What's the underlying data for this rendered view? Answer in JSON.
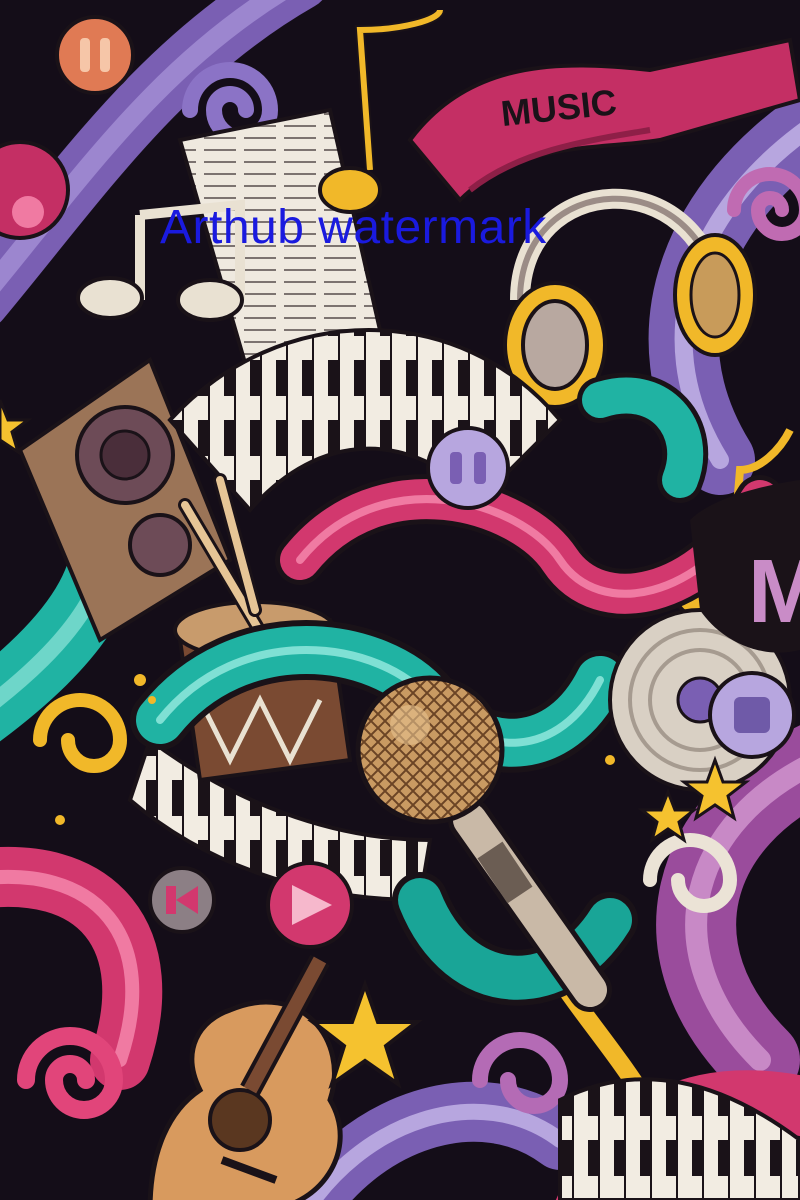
{
  "artwork": {
    "banner_text": "MUSIC",
    "side_letter": "M",
    "watermark": "Arthub watermark",
    "palette": {
      "background": "#140d18",
      "purple": "#7a5fb3",
      "lavender": "#b7a6df",
      "magenta": "#d2386e",
      "pink": "#ea5c8d",
      "teal": "#20b3a3",
      "gold": "#f1b829",
      "cream": "#e9e1d2",
      "brown": "#8a5a3c"
    }
  }
}
